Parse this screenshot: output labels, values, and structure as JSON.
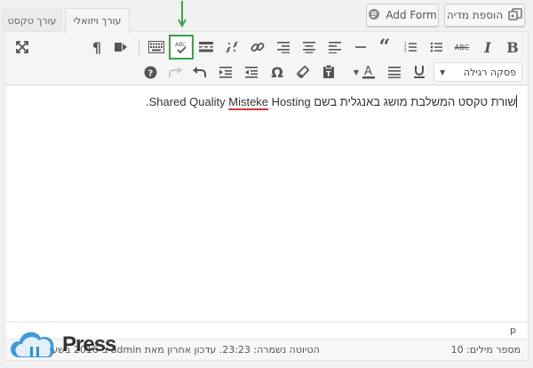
{
  "header": {
    "add_media_label": "הוספת מדיה",
    "add_form_label": "Add Form",
    "tab_visual": "עורך ויזואלי",
    "tab_text": "עורך טקסט"
  },
  "toolbar": {
    "row1": [
      "bold-icon",
      "italic-icon",
      "strikethrough-icon",
      "bulleted-list-icon",
      "numbered-list-icon",
      "blockquote-icon",
      "horizontal-line-icon",
      "align-left-icon",
      "align-center-icon",
      "align-right-icon",
      "insert-link-icon",
      "remove-link-icon",
      "read-more-icon",
      "spellcheck-icon",
      "toolbar-toggle-icon",
      "rtl-icon",
      "paragraph-mark-icon",
      "fullscreen-icon"
    ],
    "row2": [
      "text-color-icon",
      "underline-icon",
      "justify-icon",
      "paste-text-icon",
      "clear-formatting-icon",
      "special-character-icon",
      "outdent-icon",
      "indent-icon",
      "undo-icon",
      "redo-icon",
      "help-icon"
    ],
    "format_select": "פסקה רגילה",
    "highlighted_tool": "spellcheck-icon",
    "highlight_color": "#3fa14b"
  },
  "content": {
    "before": "שורת טקסט המשלבת מושג באנגלית בשם Shared Quality ",
    "misspelled": "Misteke",
    "after": " Hosting.",
    "misspelled_color": "#d63638"
  },
  "pathbar": {
    "path": "p"
  },
  "status": {
    "word_count": "מספר מילים: 10",
    "draft": "הטיוטה נשמרה: 23:23. עדכון אחרון מאת admin ב-2016 בשעה 23:13"
  },
  "logo": {
    "text": "Press"
  }
}
